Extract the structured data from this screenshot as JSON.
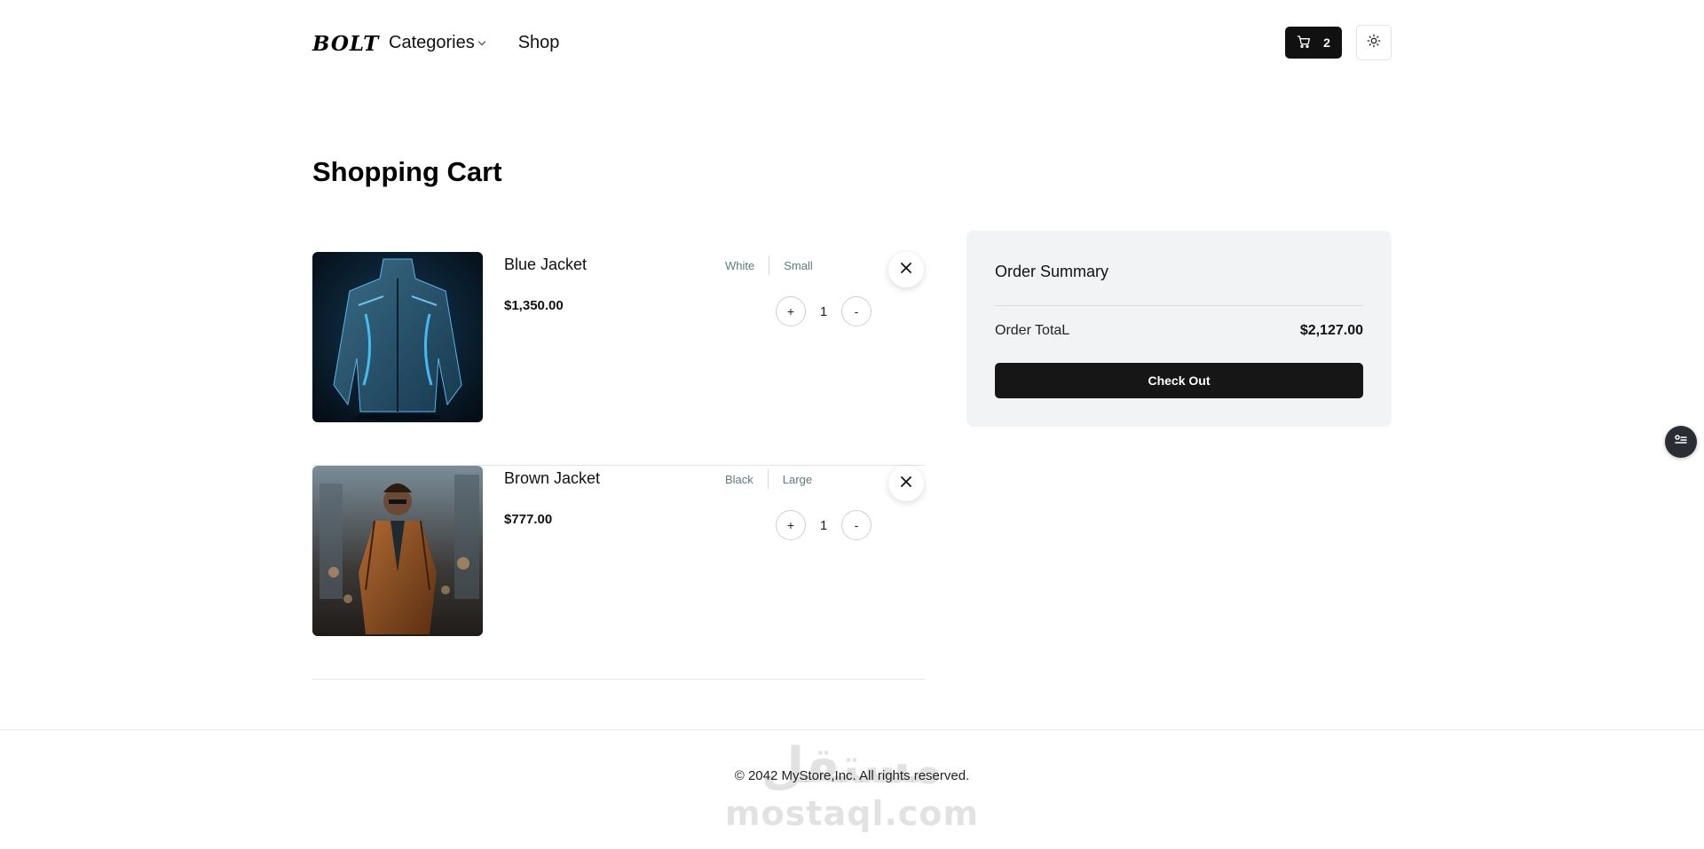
{
  "header": {
    "logo": "BOLT",
    "nav": [
      {
        "label": "Categories",
        "has_dropdown": true
      },
      {
        "label": "Shop",
        "has_dropdown": false
      }
    ],
    "cart_count": "2",
    "cart_icon": "cart-icon",
    "theme_icon": "sun-icon"
  },
  "page": {
    "title": "Shopping Cart"
  },
  "cart": {
    "items": [
      {
        "name": "Blue Jacket",
        "price": "$1,350.00",
        "color": "White",
        "size": "Small",
        "quantity": "1",
        "plus_label": "+",
        "minus_label": "-"
      },
      {
        "name": "Brown Jacket",
        "price": "$777.00",
        "color": "Black",
        "size": "Large",
        "quantity": "1",
        "plus_label": "+",
        "minus_label": "-"
      }
    ]
  },
  "summary": {
    "title": "Order Summary",
    "total_label": "Order TotaL",
    "total_value": "$2,127.00",
    "checkout_label": "Check Out"
  },
  "footer": {
    "copyright": "© 2042 MyStore,Inc. All rights reserved.",
    "watermark_arabic": "مستقل",
    "watermark_latin": "mostaql.com"
  },
  "colors": {
    "accent": "#111111",
    "summary_bg": "#f2f3f5",
    "attr_text": "#5f7a7a"
  }
}
